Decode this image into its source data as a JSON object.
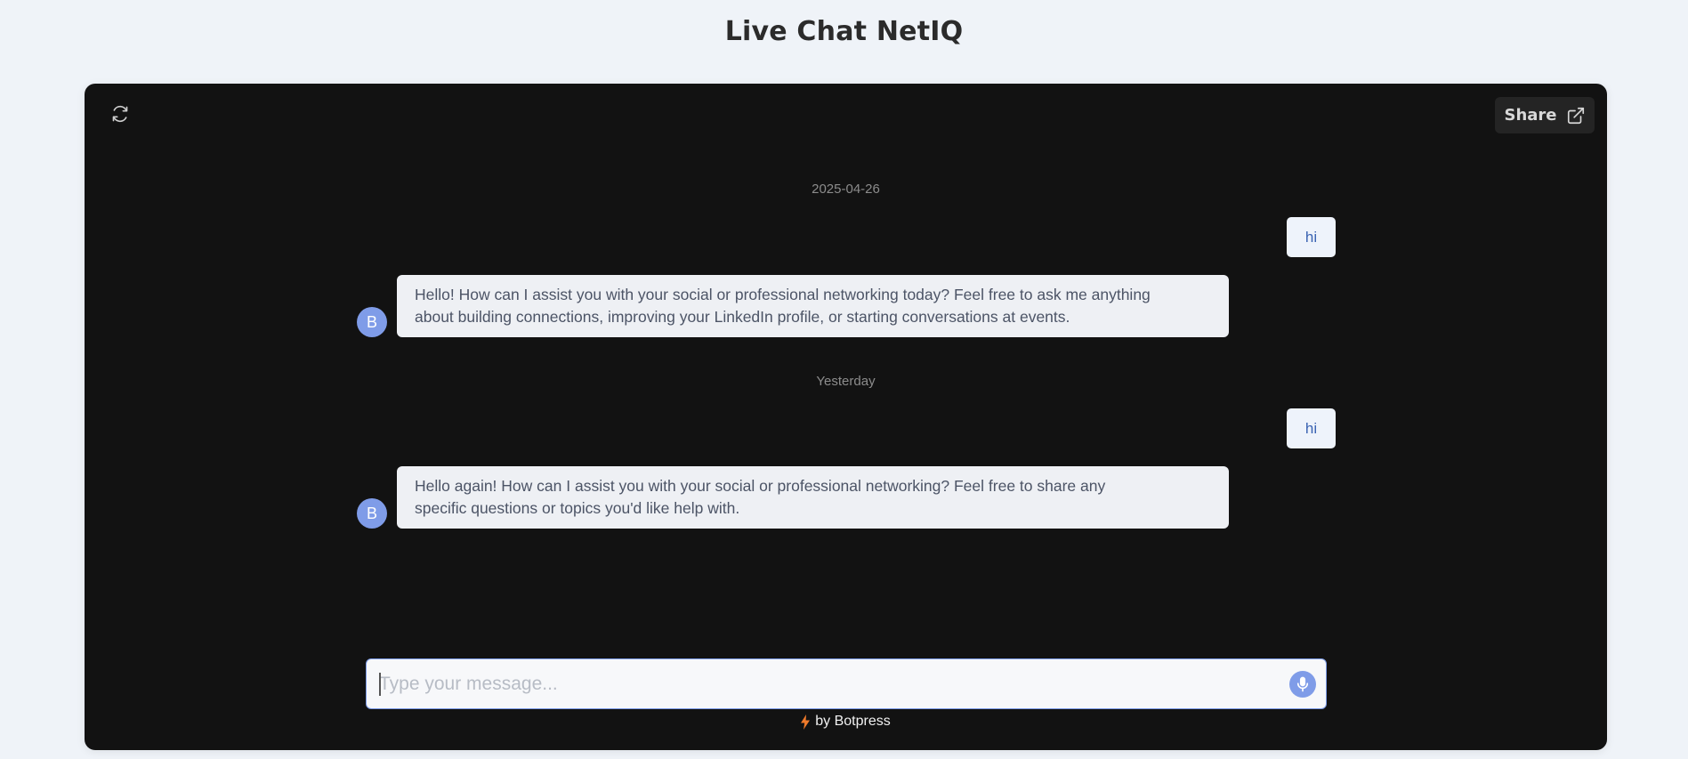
{
  "page": {
    "title": "Live Chat NetIQ"
  },
  "header": {
    "share_label": "Share"
  },
  "messages": {
    "date1": "2025-04-26",
    "user1": "hi",
    "bot_avatar1": "B",
    "bot1_line1": "Hello! How can I assist you with your social or professional networking today? Feel free to ask me anything",
    "bot1_line2": "about building connections, improving your LinkedIn profile, or starting conversations at events.",
    "date2": "Yesterday",
    "user2": "hi",
    "bot_avatar2": "B",
    "bot2_line1": "Hello again! How can I assist you with your social or professional networking? Feel free to share any",
    "bot2_line2": "specific questions or topics you'd like help with."
  },
  "composer": {
    "placeholder": "Type your message..."
  },
  "footer": {
    "powered_by": "by Botpress"
  },
  "colors": {
    "background": "#eff3f8",
    "chat_bg": "#121212",
    "accent": "#7f9ce8",
    "bolt": "#f07b2b"
  },
  "icons": [
    "refresh-icon",
    "external-link-icon",
    "microphone-icon",
    "bolt-icon"
  ]
}
